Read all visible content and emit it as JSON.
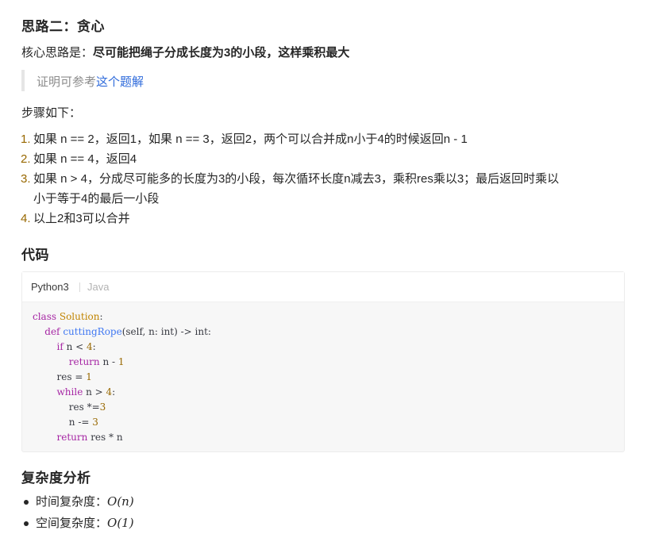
{
  "section1": {
    "heading": "思路二：贪心",
    "core_label": "核心思路是：",
    "core_bold": "尽可能把绳子分成长度为3的小段，这样乘积最大",
    "quote_text": "证明可参考",
    "quote_link": "这个题解",
    "steps_intro": "步骤如下：",
    "steps": [
      {
        "num": "1.",
        "text": "如果 n == 2，返回1，如果 n == 3，返回2，两个可以合并成n小于4的时候返回n - 1"
      },
      {
        "num": "2.",
        "text": "如果 n == 4，返回4"
      },
      {
        "num": "3.",
        "line1": "如果 n > 4，分成尽可能多的长度为3的小段，每次循环长度n减去3，乘积res乘以3；最后返回时乘以",
        "line2": "小于等于4的最后一小段"
      },
      {
        "num": "4.",
        "text": "以上2和3可以合并"
      }
    ]
  },
  "section2": {
    "heading": "代码",
    "tabs": [
      "Python3",
      "Java"
    ],
    "code": {
      "l1_kw": "class",
      "l1_name": "Solution",
      "l1_rest": ":",
      "l2_kw": "def",
      "l2_name": "cuttingRope",
      "l2_rest": "(self, n: int) -> int:",
      "l3_kw": "if",
      "l3_rest": " n < ",
      "l3_num": "4",
      "l3_end": ":",
      "l4_kw": "return",
      "l4_rest": " n - ",
      "l4_num": "1",
      "l5_rest": "res = ",
      "l5_num": "1",
      "l6_kw": "while",
      "l6_rest": " n > ",
      "l6_num": "4",
      "l6_end": ":",
      "l7_rest": "res *=",
      "l7_num": "3",
      "l8_rest": "n -= ",
      "l8_num": "3",
      "l9_kw": "return",
      "l9_rest": " res * n"
    }
  },
  "section3": {
    "heading": "复杂度分析",
    "items": [
      {
        "label": "时间复杂度：",
        "value": "O(n)"
      },
      {
        "label": "空间复杂度：",
        "value": "O(1)"
      }
    ]
  }
}
